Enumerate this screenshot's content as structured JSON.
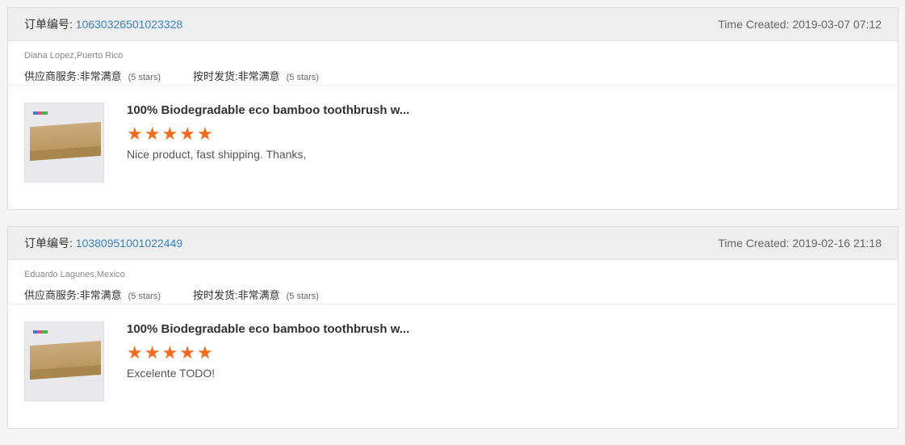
{
  "orders": [
    {
      "order_label": "订单编号:",
      "order_id": "10630326501023328",
      "time_created": "Time Created: 2019-03-07 07:12",
      "buyer": "Diana Lopez,Puerto Rico",
      "supplier_service_label": "供应商服务:",
      "supplier_service_value": "非常满意",
      "supplier_service_stars": "(5 stars)",
      "shipping_label": "按时发货:",
      "shipping_value": "非常满意",
      "shipping_stars": "(5 stars)",
      "product_title": "100% Biodegradable eco bamboo toothbrush w...",
      "rating": 5,
      "review": "Nice product, fast shipping.  Thanks,"
    },
    {
      "order_label": "订单编号:",
      "order_id": "10380951001022449",
      "time_created": "Time Created: 2019-02-16 21:18",
      "buyer": "Eduardo Lagunes,Mexico",
      "supplier_service_label": "供应商服务:",
      "supplier_service_value": "非常满意",
      "supplier_service_stars": "(5 stars)",
      "shipping_label": "按时发货:",
      "shipping_value": "非常满意",
      "shipping_stars": "(5 stars)",
      "product_title": "100% Biodegradable eco bamboo toothbrush w...",
      "rating": 5,
      "review": "Excelente TODO!"
    }
  ],
  "colors": {
    "link": "#3a84c4",
    "star": "#f46a1f",
    "header_bg": "#eeeeee"
  },
  "icons": {
    "star": "star-icon",
    "product_image": "product-thumbnail"
  }
}
